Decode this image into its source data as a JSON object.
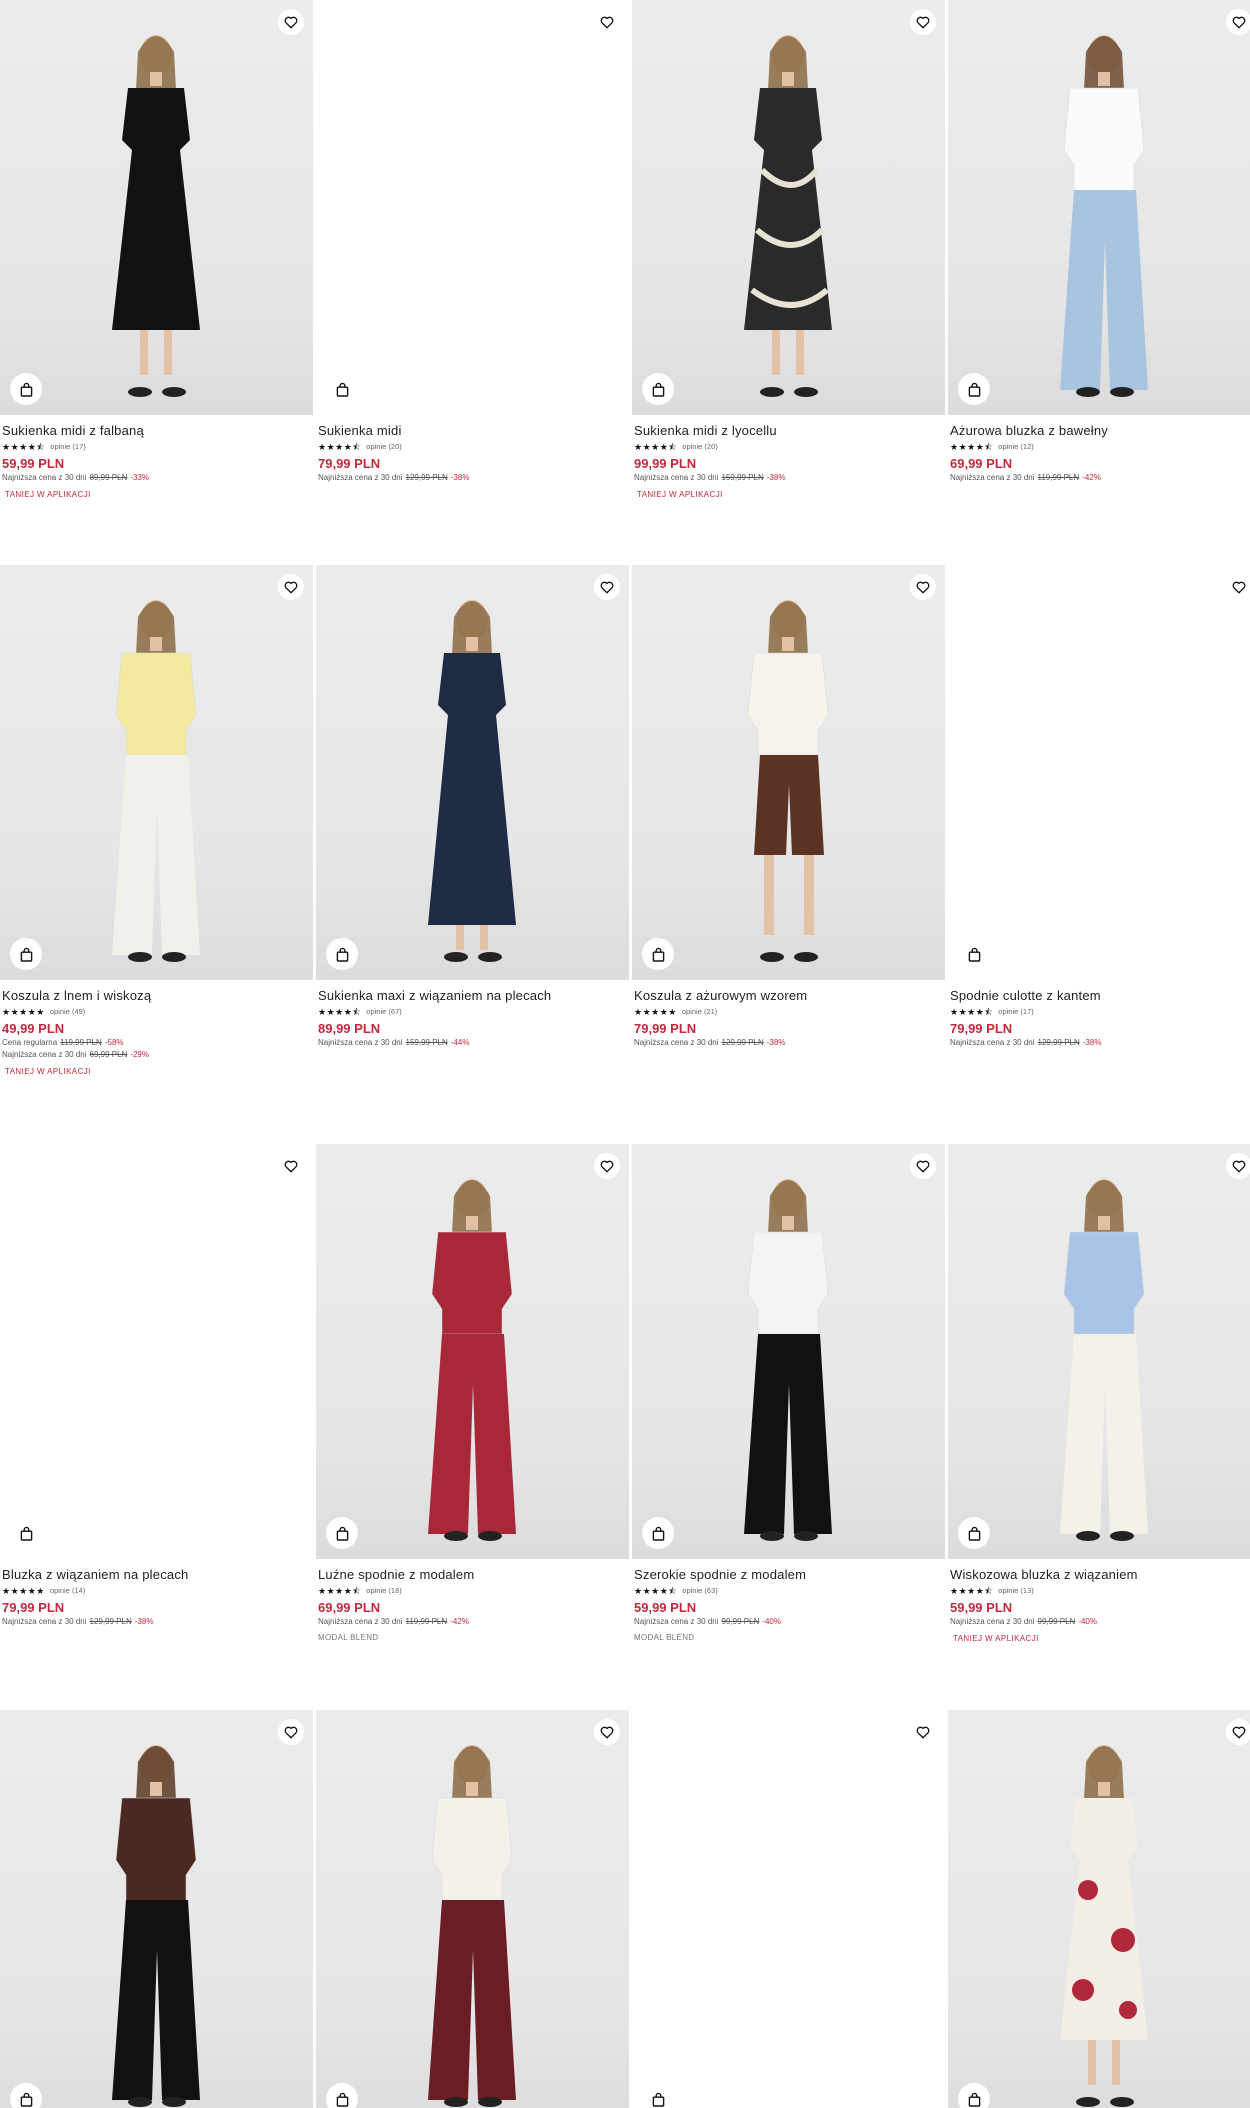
{
  "colors": {
    "price": "#c4283c",
    "text": "#222222",
    "app_tag": "#c4283c"
  },
  "icons": {
    "favorite": "heart-outline",
    "bag": "shopping-bag"
  },
  "products": [
    {
      "title": "Sukienka midi z falbaną",
      "stars": "★★★★⯪",
      "reviews": "opinie (17)",
      "price": "59,99 PLN",
      "lowest_label": "Najniższa cena z 30 dni",
      "lowest_old": "89,99 PLN",
      "lowest_pct": "-33%",
      "app": "TANIEJ W APLIKACJI"
    },
    {
      "title": "Sukienka midi",
      "stars": "★★★★⯪",
      "reviews": "opinie (20)",
      "price": "79,99 PLN",
      "lowest_label": "Najniższa cena z 30 dni",
      "lowest_old": "129,99 PLN",
      "lowest_pct": "-38%"
    },
    {
      "title": "Sukienka midi z lyocellu",
      "stars": "★★★★⯪",
      "reviews": "opinie (20)",
      "price": "99,99 PLN",
      "lowest_label": "Najniższa cena z 30 dni",
      "lowest_old": "159,99 PLN",
      "lowest_pct": "-38%",
      "app": "TANIEJ W APLIKACJI"
    },
    {
      "title": "Ażurowa bluzka z bawełny",
      "stars": "★★★★⯪",
      "reviews": "opinie (12)",
      "price": "69,99 PLN",
      "lowest_label": "Najniższa cena z 30 dni",
      "lowest_old": "119,99 PLN",
      "lowest_pct": "-42%"
    },
    {
      "title": "Koszula z lnem i wiskozą",
      "stars": "★★★★★",
      "reviews": "opinie (49)",
      "price": "49,99 PLN",
      "regular_label": "Cena regularna",
      "regular_old": "119,99 PLN",
      "regular_pct": "-58%",
      "lowest_label": "Najniższa cena z 30 dni",
      "lowest_old": "69,99 PLN",
      "lowest_pct": "-29%",
      "app": "TANIEJ W APLIKACJI"
    },
    {
      "title": "Sukienka maxi z wiązaniem na plecach",
      "stars": "★★★★⯪",
      "reviews": "opinie (67)",
      "price": "89,99 PLN",
      "lowest_label": "Najniższa cena z 30 dni",
      "lowest_old": "159,99 PLN",
      "lowest_pct": "-44%"
    },
    {
      "title": "Koszula z ażurowym wzorem",
      "stars": "★★★★★",
      "reviews": "opinie (21)",
      "price": "79,99 PLN",
      "lowest_label": "Najniższa cena z 30 dni",
      "lowest_old": "129,99 PLN",
      "lowest_pct": "-38%"
    },
    {
      "title": "Spodnie culotte z kantem",
      "stars": "★★★★⯪",
      "reviews": "opinie (17)",
      "price": "79,99 PLN",
      "lowest_label": "Najniższa cena z 30 dni",
      "lowest_old": "129,99 PLN",
      "lowest_pct": "-38%"
    },
    {
      "title": "Bluzka z wiązaniem na plecach",
      "stars": "★★★★★",
      "reviews": "opinie (14)",
      "price": "79,99 PLN",
      "lowest_label": "Najniższa cena z 30 dni",
      "lowest_old": "129,99 PLN",
      "lowest_pct": "-38%"
    },
    {
      "title": "Luźne spodnie z modalem",
      "stars": "★★★★⯪",
      "reviews": "opinie (18)",
      "price": "69,99 PLN",
      "lowest_label": "Najniższa cena z 30 dni",
      "lowest_old": "119,99 PLN",
      "lowest_pct": "-42%",
      "tag": "MODAL BLEND"
    },
    {
      "title": "Szerokie spodnie z modalem",
      "stars": "★★★★⯪",
      "reviews": "opinie (63)",
      "price": "59,99 PLN",
      "lowest_label": "Najniższa cena z 30 dni",
      "lowest_old": "99,99 PLN",
      "lowest_pct": "-40%",
      "tag": "MODAL BLEND"
    },
    {
      "title": "Wiskozowa bluzka z wiązaniem",
      "stars": "★★★★⯪",
      "reviews": "opinie (13)",
      "price": "59,99 PLN",
      "lowest_label": "Najniższa cena z 30 dni",
      "lowest_old": "99,99 PLN",
      "lowest_pct": "-40%",
      "app": "TANIEJ W APLIKACJI"
    },
    {
      "title": "",
      "stars": "",
      "reviews": "",
      "price": ""
    },
    {
      "title": "",
      "stars": "",
      "reviews": "",
      "price": ""
    },
    {
      "title": "",
      "stars": "",
      "reviews": "",
      "price": ""
    },
    {
      "title": "",
      "stars": "",
      "reviews": "",
      "price": ""
    }
  ]
}
